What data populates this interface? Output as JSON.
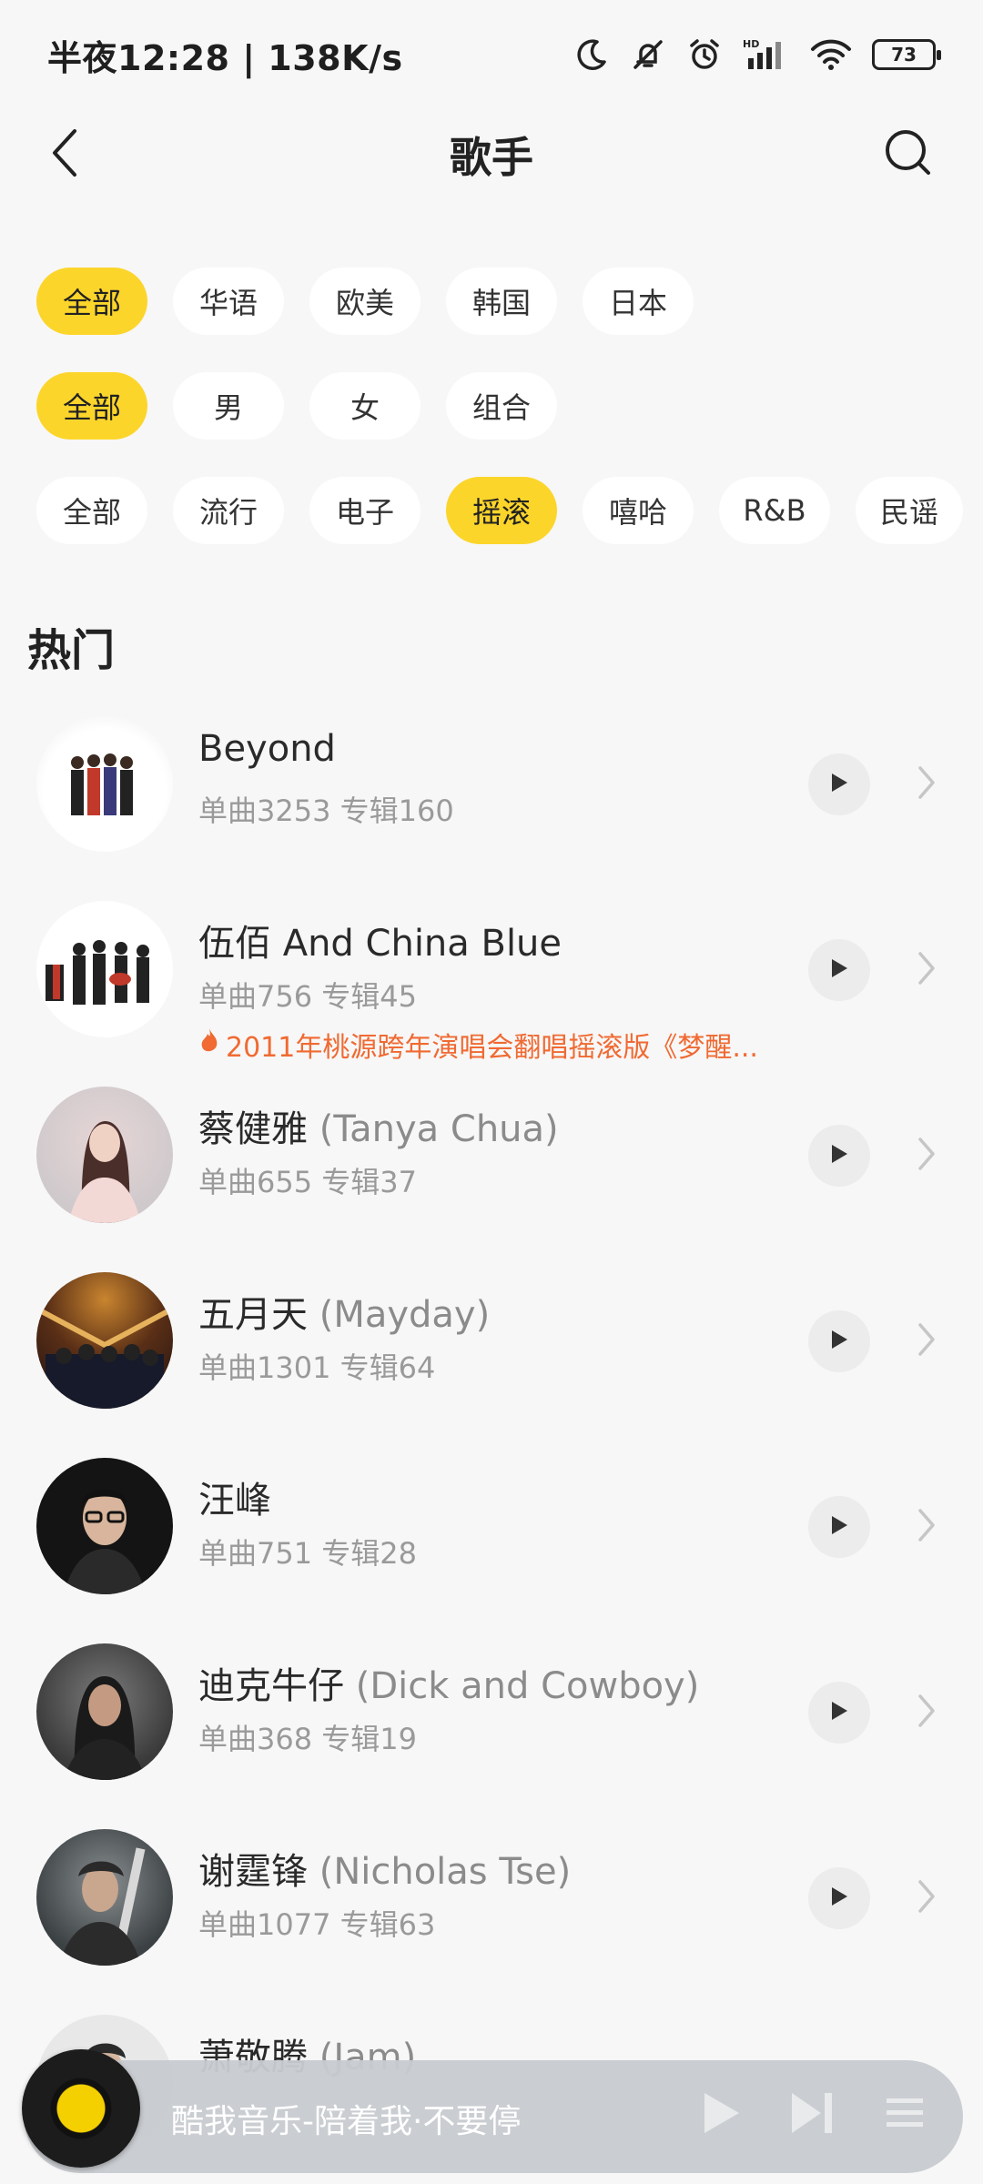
{
  "status_bar": {
    "time_speed": "半夜12:28 | 138K/s",
    "battery": "73",
    "icons": [
      "moon-icon",
      "bell-off-icon",
      "alarm-icon",
      "hd-signal-icon",
      "wifi-icon",
      "battery-icon"
    ]
  },
  "header": {
    "title": "歌手",
    "back_icon": "chevron-left-icon",
    "search_icon": "search-icon"
  },
  "filters": {
    "region": {
      "options": [
        "全部",
        "华语",
        "欧美",
        "韩国",
        "日本"
      ],
      "selected": "全部"
    },
    "gender": {
      "options": [
        "全部",
        "男",
        "女",
        "组合"
      ],
      "selected": "全部"
    },
    "genre": {
      "options": [
        "全部",
        "流行",
        "电子",
        "摇滚",
        "嘻哈",
        "R&B",
        "民谣"
      ],
      "selected": "摇滚"
    }
  },
  "section": {
    "title": "热门"
  },
  "artists": [
    {
      "name": "Beyond",
      "alias": "",
      "stats": "单曲3253 专辑160",
      "note": ""
    },
    {
      "name": "伍佰 And China Blue",
      "alias": "",
      "stats": "单曲756 专辑45",
      "note": "2011年桃源跨年演唱会翻唱摇滚版《梦醒..."
    },
    {
      "name": "蔡健雅",
      "alias": "(Tanya Chua)",
      "stats": "单曲655 专辑37",
      "note": ""
    },
    {
      "name": "五月天",
      "alias": "(Mayday)",
      "stats": "单曲1301 专辑64",
      "note": ""
    },
    {
      "name": "汪峰",
      "alias": "",
      "stats": "单曲751 专辑28",
      "note": ""
    },
    {
      "name": "迪克牛仔",
      "alias": "(Dick and Cowboy)",
      "stats": "单曲368 专辑19",
      "note": ""
    },
    {
      "name": "谢霆锋",
      "alias": "(Nicholas Tse)",
      "stats": "单曲1077 专辑63",
      "note": ""
    },
    {
      "name": "萧敬腾",
      "alias": "(Jam)",
      "stats": "",
      "note": ""
    }
  ],
  "player": {
    "now_playing": "酷我音乐-陪着我·不要停",
    "controls": [
      "play-icon",
      "next-icon",
      "playlist-icon"
    ]
  },
  "colors": {
    "accent": "#fcd52b",
    "note": "#f06a32",
    "background": "#f7f7f7"
  }
}
